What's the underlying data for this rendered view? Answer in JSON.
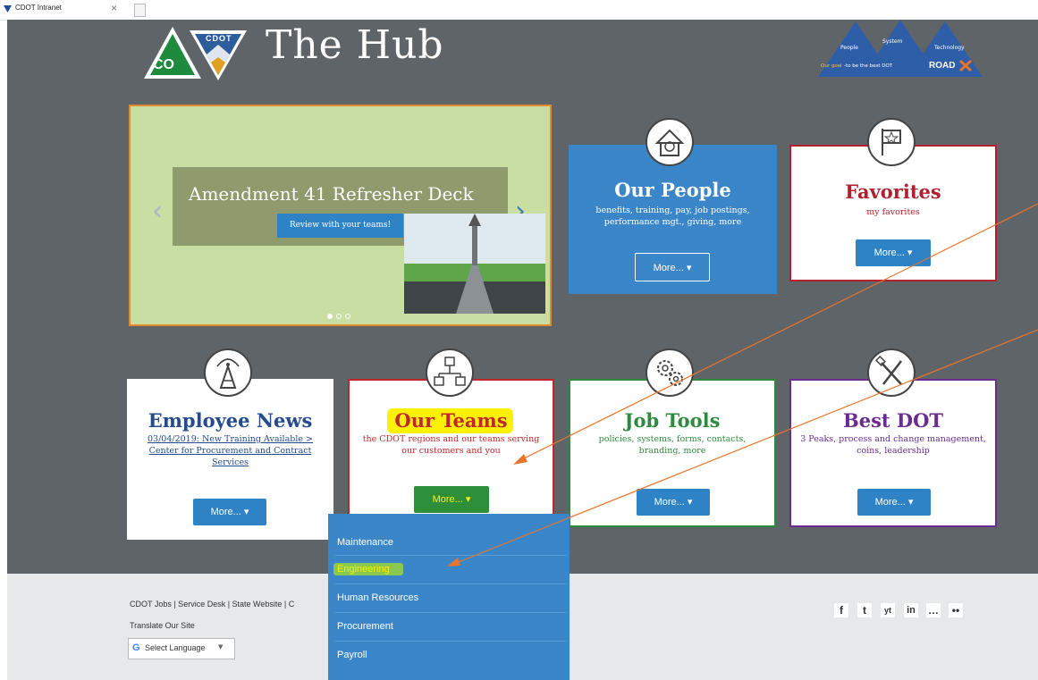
{
  "browser": {
    "tab_title": "CDOT Intranet",
    "tab_close": "×"
  },
  "header": {
    "logo_badge": "CO",
    "logo_text": "CDOT",
    "title": "The Hub",
    "roadx": {
      "people": "People",
      "system": "System",
      "technology": "Technology",
      "goal_prefix": "Our goal",
      "goal_text": "-to be the best DOT",
      "brand": "ROAD"
    }
  },
  "carousel": {
    "title": "Amendment 41 Refresher Deck",
    "button": "Review with your teams!",
    "prev": "‹",
    "next": "›"
  },
  "tiles": {
    "people": {
      "title": "Our People",
      "desc": "benefits, training, pay, job postings, performance mgt., giving, more",
      "more": "More... ▾"
    },
    "favorites": {
      "title": "Favorites",
      "desc": "my favorites",
      "more": "More... ▾"
    },
    "news": {
      "title": "Employee News",
      "desc": "03/04/2019: New Training Available > Center for Procurement and Contract Services",
      "more": "More... ▾"
    },
    "teams": {
      "title": "Our Teams",
      "desc": "the CDOT regions and our teams serving our customers and you",
      "more": "More... ▾"
    },
    "tools": {
      "title": "Job Tools",
      "desc": "policies, systems, forms, contacts, branding, more",
      "more": "More... ▾"
    },
    "bestdot": {
      "title": "Best DOT",
      "desc": "3 Peaks, process and change management, coins, leadership",
      "more": "More... ▾"
    }
  },
  "dropdown": {
    "items": [
      "Maintenance",
      "Engineering",
      "Human Resources",
      "Procurement",
      "Payroll"
    ]
  },
  "footer": {
    "links": "CDOT Jobs | Service Desk | State Website | C",
    "translate": "Translate Our Site",
    "select_language": "Select Language",
    "select_arrow": "▼",
    "google_g": "G"
  },
  "social": [
    "f",
    "t",
    "yt",
    "in",
    "…",
    "••"
  ],
  "colors": {
    "page_bg": "#5f6469",
    "people_blue": "#3a86c8",
    "favorites_red": "#b21f2d",
    "news_blue": "#244a8f",
    "teams_red": "#c0272d",
    "tools_green": "#2e8b3e",
    "bestdot_purple": "#6a2c8f",
    "highlight_yellow": "#fff200",
    "annotation_orange": "#e8752a",
    "button_blue": "#2e82c6"
  }
}
